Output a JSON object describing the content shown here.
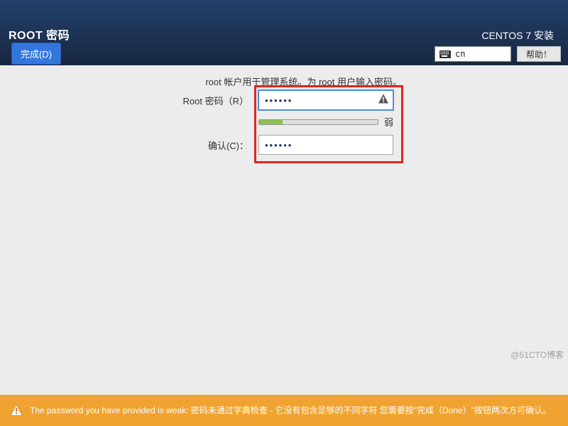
{
  "header": {
    "title": "ROOT 密码",
    "done_label": "完成(D)",
    "product": "CENTOS 7 安装",
    "language": "cn",
    "help_label": "帮助！"
  },
  "main": {
    "instruction": "root 帐户用于管理系统。为 root 用户输入密码。",
    "root_pw_label": "Root 密码（R）",
    "root_pw_value": "••••••",
    "confirm_label": "确认(C)：",
    "confirm_value": "••••••",
    "strength_text": "弱"
  },
  "footer": {
    "warning": "The password you have provided is weak: 密码未通过字典检查 - 它没有包含足够的不同字符 您需要按\"完成（Done）\"按钮两次方可确认。"
  },
  "watermark": "@51CTO博客"
}
